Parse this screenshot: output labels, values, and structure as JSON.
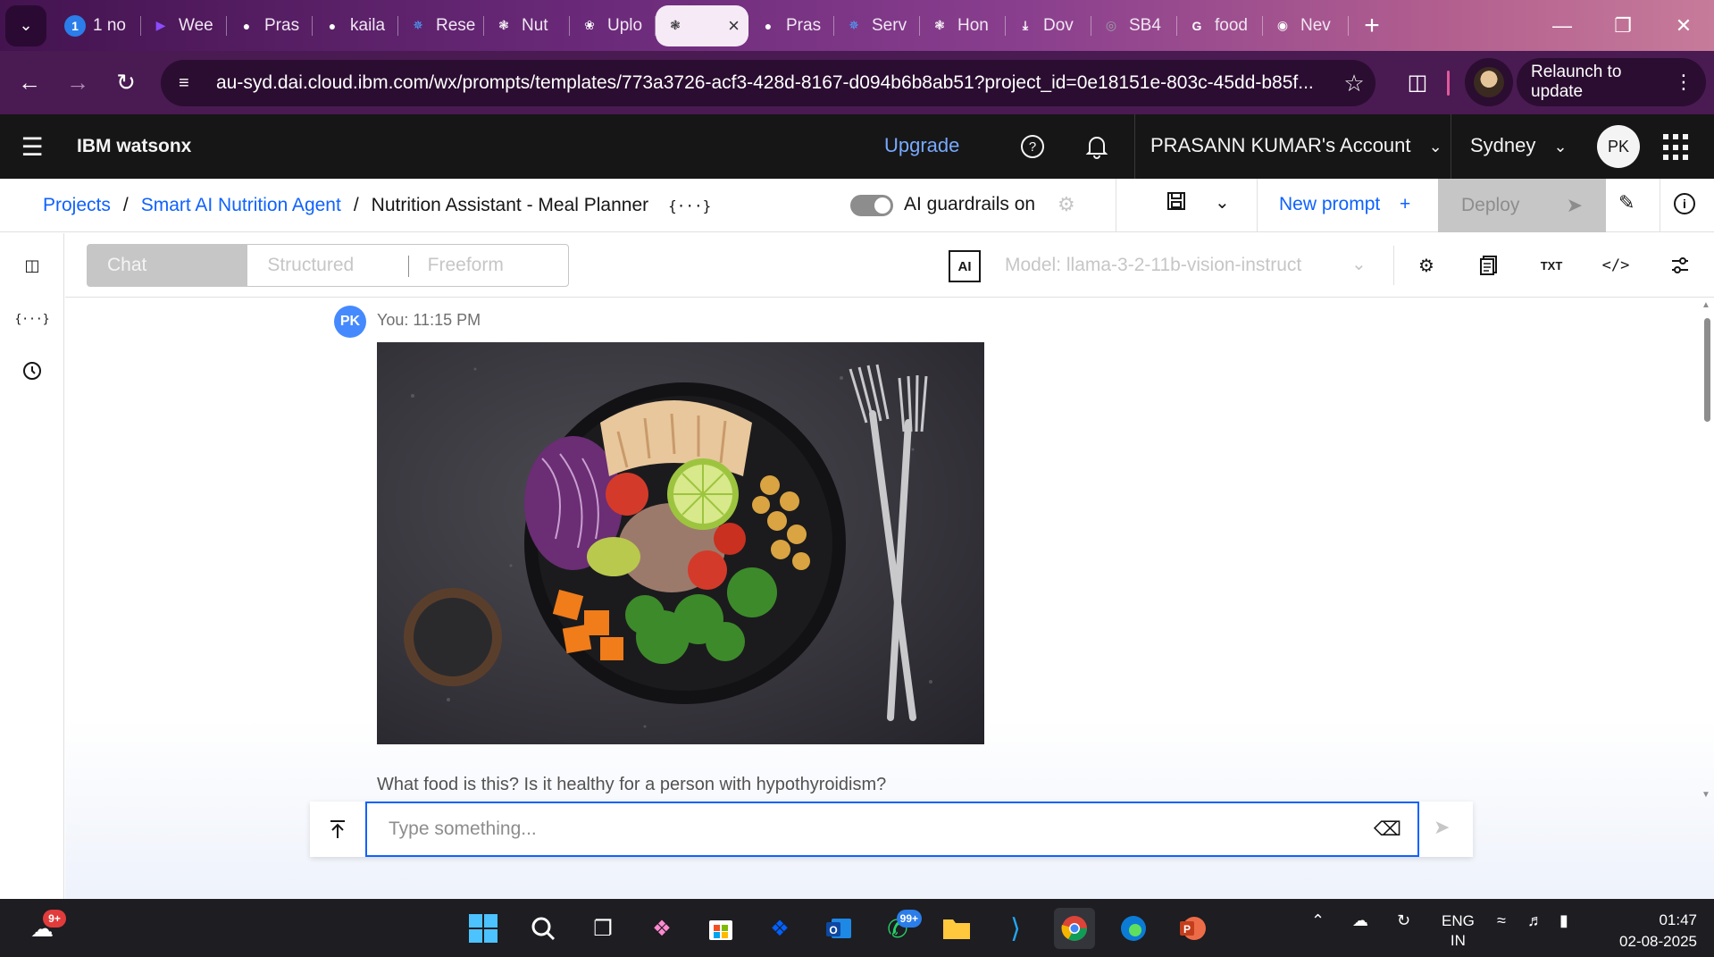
{
  "browser": {
    "tabs": [
      {
        "label": "1 no",
        "icon": "badge-one-icon",
        "color": "#2b7de9"
      },
      {
        "label": "Wee",
        "icon": "video-icon",
        "color": "#8a4dff"
      },
      {
        "label": "Pras",
        "icon": "github-icon",
        "color": "#ffffff"
      },
      {
        "label": "kaila",
        "icon": "github-icon",
        "color": "#ffffff"
      },
      {
        "label": "Rese",
        "icon": "sparkle-icon",
        "color": "#4aa3ff"
      },
      {
        "label": "Nut",
        "icon": "aperture-icon",
        "color": "#ffffff"
      },
      {
        "label": "Uplo",
        "icon": "openai-icon",
        "color": "#ffffff"
      },
      {
        "label": "",
        "icon": "aperture-icon",
        "color": "#333333",
        "active": true
      },
      {
        "label": "Pras",
        "icon": "github-icon",
        "color": "#ffffff"
      },
      {
        "label": "Serv",
        "icon": "sparkle-icon",
        "color": "#4aa3ff"
      },
      {
        "label": "Hon",
        "icon": "aperture-icon",
        "color": "#ffffff"
      },
      {
        "label": "Dov",
        "icon": "download-icon",
        "color": "#ffffff"
      },
      {
        "label": "SB4",
        "icon": "globe-icon",
        "color": "#9aa0a6"
      },
      {
        "label": "food",
        "icon": "google-icon",
        "color": "#ffffff"
      },
      {
        "label": "Nev",
        "icon": "chrome-icon",
        "color": "#ffffff"
      }
    ],
    "url": "au-syd.dai.cloud.ibm.com/wx/prompts/templates/773a3726-acf3-428d-8167-d094b6b8ab51?project_id=0e18151e-803c-45dd-b85f...",
    "relaunch_label": "Relaunch to update"
  },
  "header": {
    "brand": "IBM watsonx",
    "upgrade": "Upgrade",
    "account": "PRASANN KUMAR's Account",
    "region": "Sydney",
    "avatar": "PK"
  },
  "breadcrumb": {
    "projects": "Projects",
    "project": "Smart AI Nutrition Agent",
    "current": "Nutrition Assistant - Meal Planner",
    "variable_glyph": "{···}"
  },
  "actions": {
    "guardrails": "AI guardrails on",
    "new_prompt": "New prompt",
    "deploy": "Deploy"
  },
  "toolbar": {
    "modes": [
      "Chat",
      "Structured",
      "Freeform"
    ],
    "ai_badge": "AI",
    "model": "Model: llama-3-2-11b-vision-instruct",
    "txt": "TXT"
  },
  "chat": {
    "avatar": "PK",
    "meta": "You: 11:15 PM",
    "message": "What food is this? Is it healthy for a person with hypothyroidism?",
    "placeholder": "Type something..."
  },
  "taskbar": {
    "weather_badge": "9+",
    "whatsapp_badge": "99+",
    "lang_top": "ENG",
    "lang_bottom": "IN",
    "time": "01:47",
    "date": "02-08-2025"
  }
}
